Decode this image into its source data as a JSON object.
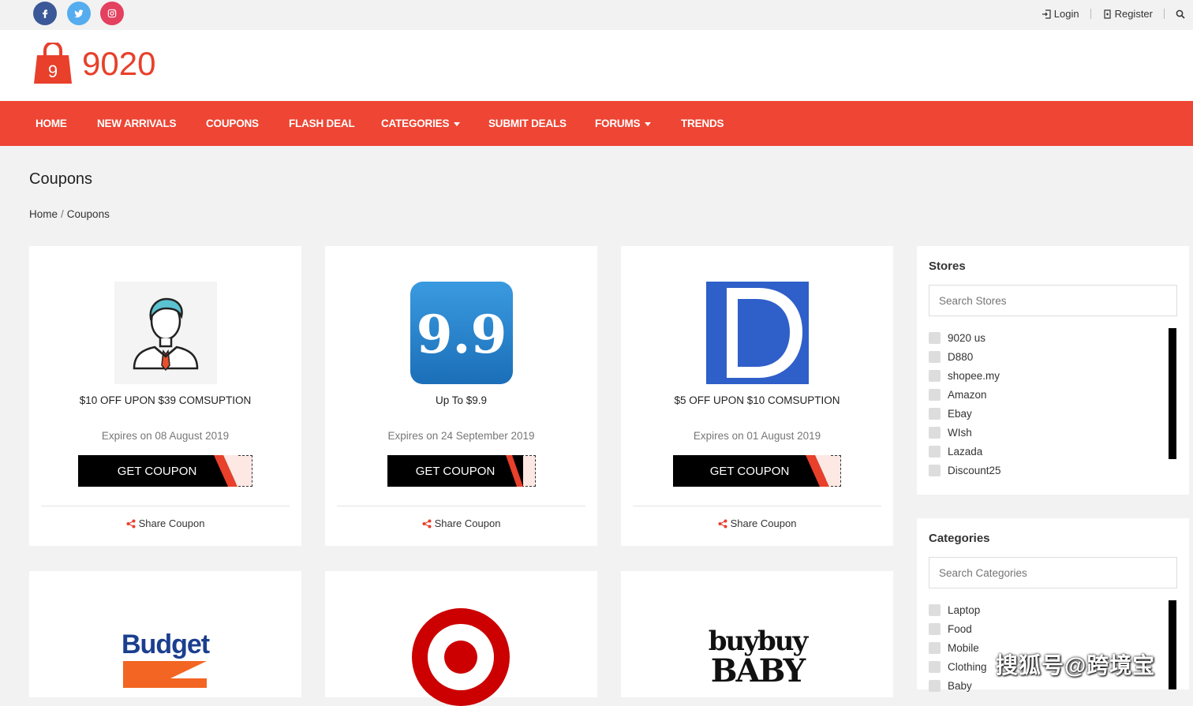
{
  "topbar": {
    "login": "Login",
    "register": "Register"
  },
  "logo": {
    "text": "9020",
    "bag_number": "9"
  },
  "nav": {
    "items": [
      "HOME",
      "NEW ARRIVALS",
      "COUPONS",
      "FLASH DEAL",
      "CATEGORIES",
      "SUBMIT DEALS",
      "FORUMS",
      "TRENDS"
    ]
  },
  "page": {
    "title": "Coupons",
    "breadcrumb": {
      "home": "Home",
      "sep": "/",
      "current": "Coupons"
    }
  },
  "coupons": [
    {
      "title": "$10 OFF UPON $39 COMSUPTION",
      "expires": "Expires on 08 August 2019",
      "button": "GET COUPON",
      "share": "Share Coupon"
    },
    {
      "title": "Up To $9.9",
      "expires": "Expires on 24 September 2019",
      "button": "GET COUPON",
      "share": "Share Coupon"
    },
    {
      "title": "$5 OFF UPON $10 COMSUPTION",
      "expires": "Expires on 01 August 2019",
      "button": "GET COUPON",
      "share": "Share Coupon"
    }
  ],
  "logos": {
    "c2": "9.9",
    "c3": "D",
    "c4": "Budget",
    "c6_line1": "buybuy",
    "c6_line2": "BABY"
  },
  "sidebar": {
    "stores": {
      "heading": "Stores",
      "placeholder": "Search Stores",
      "items": [
        "9020 us",
        "D880",
        "shopee.my",
        "Amazon",
        "Ebay",
        "WIsh",
        "Lazada",
        "Discount25"
      ]
    },
    "categories": {
      "heading": "Categories",
      "placeholder": "Search Categories",
      "items": [
        "Laptop",
        "Food",
        "Mobile",
        "Clothing",
        "Baby"
      ]
    }
  },
  "watermark": "搜狐号@跨境宝",
  "colors": {
    "brand": "#ee4534",
    "facebook": "#3b5998",
    "twitter": "#55acee",
    "instagram": "#e4405f"
  }
}
